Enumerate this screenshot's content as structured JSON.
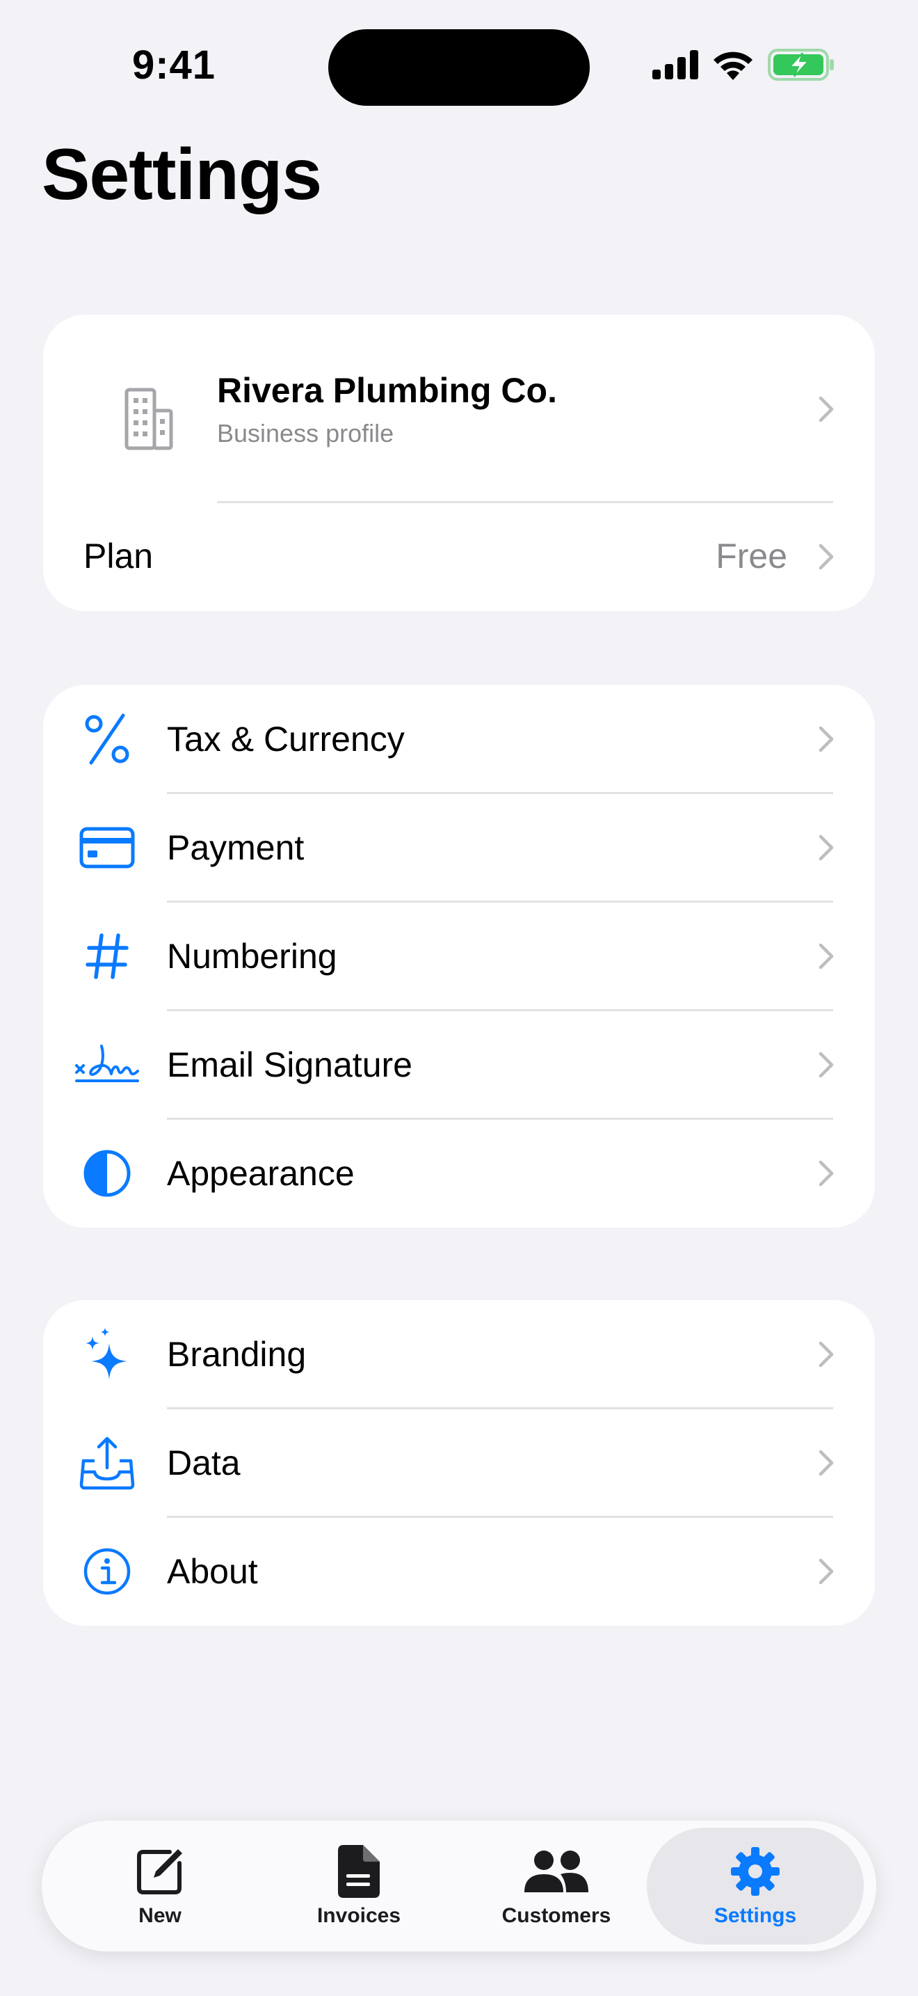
{
  "status_bar": {
    "time": "9:41"
  },
  "page": {
    "title": "Settings"
  },
  "business": {
    "name": "Rivera Plumbing Co.",
    "subtitle": "Business profile",
    "plan_label": "Plan",
    "plan_value": "Free"
  },
  "section2": {
    "items": [
      {
        "label": "Tax & Currency",
        "icon": "percent-icon"
      },
      {
        "label": "Payment",
        "icon": "credit-card-icon"
      },
      {
        "label": "Numbering",
        "icon": "number-sign-icon"
      },
      {
        "label": "Email Signature",
        "icon": "signature-icon"
      },
      {
        "label": "Appearance",
        "icon": "appearance-icon"
      }
    ]
  },
  "section3": {
    "items": [
      {
        "label": "Branding",
        "icon": "sparkles-icon"
      },
      {
        "label": "Data",
        "icon": "tray-upload-icon"
      },
      {
        "label": "About",
        "icon": "info-icon"
      }
    ]
  },
  "tabbar": {
    "tabs": [
      {
        "label": "New",
        "icon": "compose-icon"
      },
      {
        "label": "Invoices",
        "icon": "document-icon"
      },
      {
        "label": "Customers",
        "icon": "people-icon"
      },
      {
        "label": "Settings",
        "icon": "gear-icon",
        "active": true
      }
    ]
  },
  "colors": {
    "accent": "#0a7aff",
    "background": "#f2f2f7",
    "card": "#ffffff",
    "secondary_text": "#8a8a8e",
    "battery_green": "#34c759"
  }
}
